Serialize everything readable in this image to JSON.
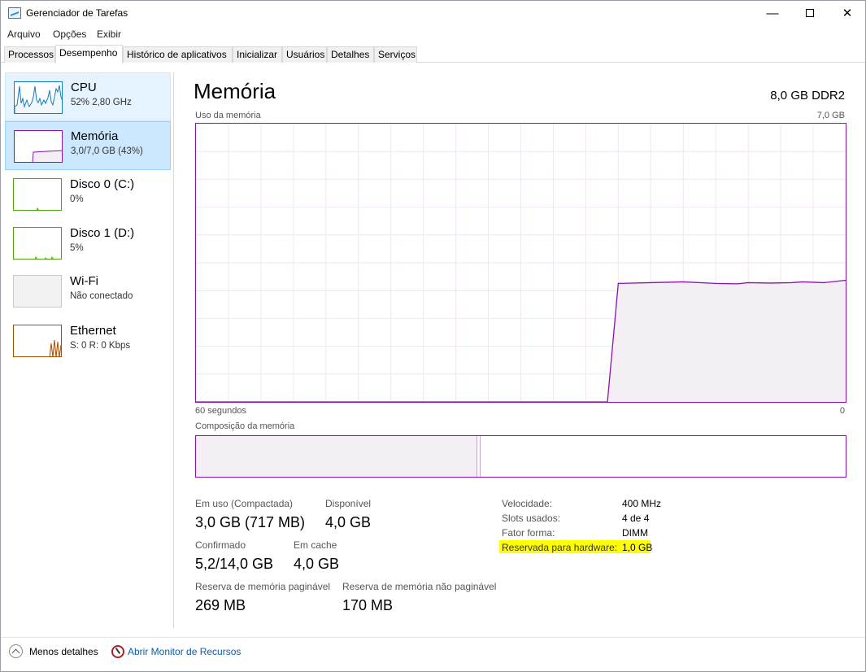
{
  "window": {
    "title": "Gerenciador de Tarefas",
    "controls": {
      "minimize": "—",
      "close": "✕"
    }
  },
  "menu": [
    "Arquivo",
    "Opções",
    "Exibir"
  ],
  "tabs": [
    "Processos",
    "Desempenho",
    "Histórico de aplicativos",
    "Inicializar",
    "Usuários",
    "Detalhes",
    "Serviços"
  ],
  "active_tab": "Desempenho",
  "sidebar": {
    "items": [
      {
        "name": "CPU",
        "sub": "52% 2,80 GHz",
        "color": "#117dbb",
        "icon": "cpu-graph"
      },
      {
        "name": "Memória",
        "sub": "3,0/7,0 GB (43%)",
        "color": "#8b12ae",
        "icon": "memory-graph"
      },
      {
        "name": "Disco 0 (C:)",
        "sub": "0%",
        "color": "#4da60c",
        "icon": "disk-graph"
      },
      {
        "name": "Disco 1 (D:)",
        "sub": "5%",
        "color": "#4da60c",
        "icon": "disk-graph"
      },
      {
        "name": "Wi-Fi",
        "sub": "Não conectado",
        "color": "#a6a6a6",
        "icon": "wifi-graph"
      },
      {
        "name": "Ethernet",
        "sub": "S: 0 R: 0 Kbps",
        "color": "#a74f01",
        "icon": "ethernet-graph"
      }
    ],
    "selected": 1,
    "hovered": 0
  },
  "main": {
    "title": "Memória",
    "spec": "8,0 GB DDR2",
    "usage_label": "Uso da memória",
    "usage_max": "7,0 GB",
    "time_left": "60 segundos",
    "time_right": "0",
    "composition_label": "Composição da memória",
    "stats": {
      "in_use_label": "Em uso (Compactada)",
      "in_use_value": "3,0 GB (717 MB)",
      "available_label": "Disponível",
      "available_value": "4,0 GB",
      "committed_label": "Confirmado",
      "committed_value": "5,2/14,0 GB",
      "cached_label": "Em cache",
      "cached_value": "4,0 GB",
      "paged_pool_label": "Reserva de memória paginável",
      "paged_pool_value": "269 MB",
      "nonpaged_pool_label": "Reserva de memória não paginável",
      "nonpaged_pool_value": "170 MB"
    },
    "details": [
      {
        "label": "Velocidade:",
        "value": "400 MHz"
      },
      {
        "label": "Slots usados:",
        "value": "4 de 4"
      },
      {
        "label": "Fator forma:",
        "value": "DIMM"
      },
      {
        "label": "Reservada para hardware:",
        "value": "1,0 GB",
        "highlighted": true
      }
    ]
  },
  "footer": {
    "fewer_details": "Menos detalhes",
    "open_monitor": "Abrir Monitor de Recursos"
  },
  "chart_data": {
    "type": "area",
    "title": "Uso da memória",
    "xlabel": "",
    "ylabel": "",
    "x_range_seconds": [
      60,
      0
    ],
    "ylim": [
      0,
      7.0
    ],
    "grid": true,
    "color": "#8b12ae",
    "x": [
      60,
      22,
      21,
      18,
      15,
      12,
      10,
      9,
      7,
      5,
      4,
      2,
      0
    ],
    "values": [
      0,
      0,
      2.98,
      3.0,
      3.02,
      2.98,
      2.97,
      3.0,
      2.99,
      3.0,
      3.02,
      3.0,
      3.06
    ],
    "composition": {
      "in_use_fraction": 0.43,
      "modified_fraction": 0.005
    }
  }
}
